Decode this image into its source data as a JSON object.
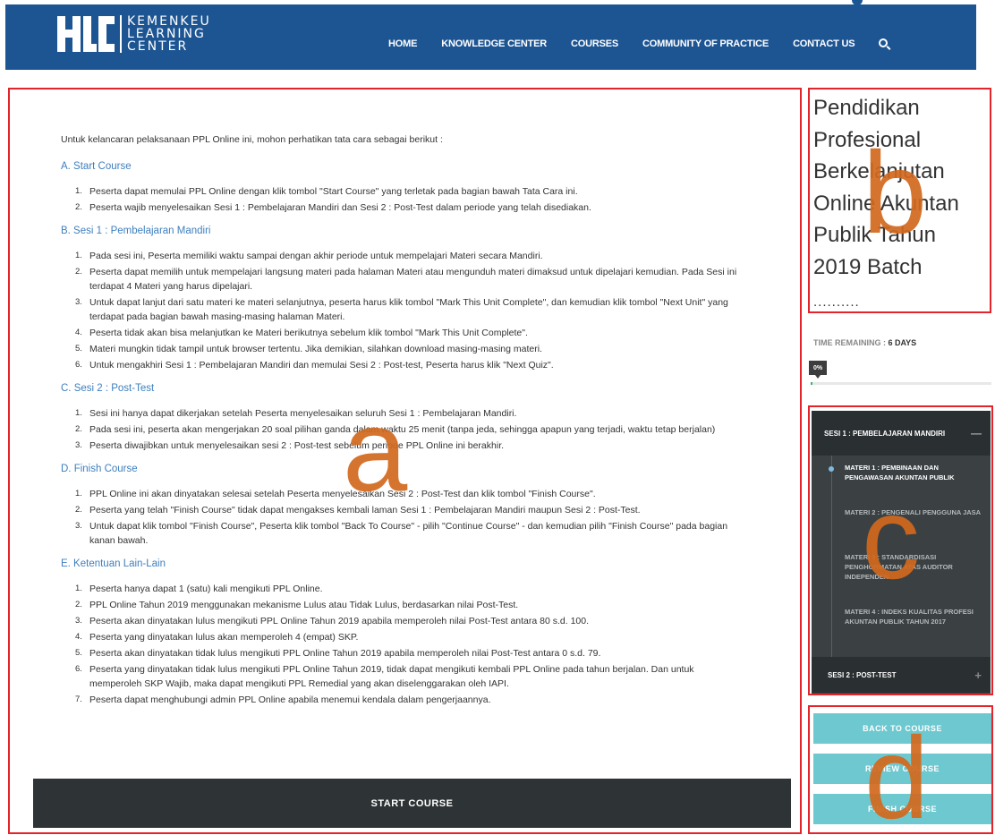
{
  "header": {
    "logo_line1": "KEMENKEU",
    "logo_line2": "LEARNING",
    "logo_line3": "CENTER",
    "nav": [
      "HOME",
      "KNOWLEDGE CENTER",
      "COURSES",
      "COMMUNITY OF PRACTICE",
      "CONTACT US"
    ],
    "search_icon": "search-icon"
  },
  "content": {
    "intro": "Untuk kelancaran pelaksanaan PPL Online ini, mohon perhatikan tata cara sebagai berikut :",
    "sections": [
      {
        "title": "A. Start Course",
        "items": [
          "Peserta dapat memulai PPL Online dengan klik tombol \"Start Course\" yang terletak pada bagian bawah Tata Cara ini.",
          "Peserta wajib menyelesaikan Sesi 1 : Pembelajaran Mandiri dan Sesi 2 : Post-Test dalam periode yang telah disediakan."
        ]
      },
      {
        "title": "B. Sesi 1 : Pembelajaran Mandiri",
        "items": [
          "Pada sesi ini, Peserta memiliki waktu sampai dengan akhir periode untuk mempelajari Materi secara Mandiri.",
          "Peserta dapat memilih untuk mempelajari langsung materi pada halaman Materi atau mengunduh materi dimaksud untuk dipelajari kemudian. Pada Sesi ini terdapat 4 Materi yang harus dipelajari.",
          "Untuk dapat lanjut dari satu materi ke materi selanjutnya, peserta harus klik tombol \"Mark This Unit Complete\", dan kemudian klik tombol \"Next Unit\" yang terdapat pada bagian bawah masing-masing halaman Materi.",
          "Peserta tidak akan bisa melanjutkan ke Materi berikutnya sebelum klik tombol \"Mark This Unit Complete\".",
          "Materi mungkin tidak tampil untuk browser tertentu. Jika demikian, silahkan download masing-masing materi.",
          "Untuk mengakhiri Sesi 1 : Pembelajaran Mandiri dan memulai Sesi 2 : Post-test, Peserta harus klik \"Next Quiz\"."
        ]
      },
      {
        "title": "C. Sesi 2 : Post-Test",
        "items": [
          "Sesi ini hanya dapat dikerjakan setelah Peserta menyelesaikan seluruh Sesi 1 : Pembelajaran Mandiri.",
          "Pada sesi ini, peserta akan mengerjakan 20 soal pilihan ganda dalam waktu 25 menit (tanpa jeda, sehingga apapun yang terjadi, waktu tetap berjalan)",
          "Peserta diwajibkan untuk menyelesaikan sesi 2 : Post-test sebelum periode PPL Online ini berakhir."
        ]
      },
      {
        "title": "D. Finish Course",
        "items": [
          "PPL Online ini akan dinyatakan selesai setelah Peserta menyelesaikan Sesi 2 : Post-Test dan klik tombol \"Finish Course\".",
          "Peserta yang telah \"Finish Course\" tidak dapat mengakses kembali laman Sesi 1 : Pembelajaran Mandiri maupun Sesi 2 : Post-Test.",
          "Untuk dapat klik tombol \"Finish Course\", Peserta klik tombol \"Back To Course\" - pilih \"Continue Course\" - dan kemudian pilih \"Finish Course\" pada bagian kanan bawah."
        ]
      },
      {
        "title": "E. Ketentuan Lain-Lain",
        "items": [
          "Peserta hanya dapat 1 (satu) kali mengikuti PPL Online.",
          "PPL Online Tahun 2019 menggunakan mekanisme Lulus atau Tidak Lulus, berdasarkan nilai Post-Test.",
          "Peserta akan dinyatakan lulus mengikuti PPL Online Tahun 2019 apabila memperoleh nilai Post-Test antara 80 s.d. 100.",
          "Peserta yang dinyatakan lulus akan memperoleh 4 (empat) SKP.",
          "Peserta akan dinyatakan tidak lulus mengikuti PPL Online Tahun 2019 apabila memperoleh nilai Post-Test antara 0 s.d. 79.",
          "Peserta yang dinyatakan tidak lulus mengikuti PPL Online Tahun 2019, tidak dapat mengikuti kembali PPL Online pada tahun berjalan. Dan untuk memperoleh SKP Wajib, maka dapat mengikuti PPL Remedial yang akan diselenggarakan oleh IAPI.",
          "Peserta dapat menghubungi admin PPL Online apabila menemui kendala dalam pengerjaannya."
        ]
      }
    ],
    "start_button": "START COURSE"
  },
  "sidebar": {
    "course_title": "Pendidikan Profesional Berkelanjutan Online Akuntan Publik Tahun 2019 Batch",
    "course_dots": "..........",
    "time_label": "TIME REMAINING : ",
    "time_value": "6 DAYS",
    "progress_label": "0%",
    "progress_fraction": 0.01,
    "modules": {
      "section1": "SESI 1 : PEMBELAJARAN MANDIRI",
      "section1_toggle": "—",
      "items": [
        "MATERI 1 : PEMBINAAN DAN PENGAWASAN AKUNTAN PUBLIK",
        "MATERI 2 : PENGENALI PENGGUNA JASA",
        "MATERI 3 : STANDARDISASI PENGHORMATAN ATAS AUDITOR INDEPENDEN",
        "MATERI 4 : INDEKS KUALITAS PROFESI AKUNTAN PUBLIK TAHUN 2017"
      ],
      "section2": "SESI 2 : POST-TEST",
      "section2_toggle": "+"
    },
    "buttons": [
      "BACK TO COURSE",
      "REVIEW COURSE",
      "FINISH COURSE"
    ]
  },
  "annotations": [
    "a",
    "b",
    "c",
    "d"
  ],
  "colors": {
    "header_bg": "#1d5593",
    "annotation_red": "#e3242b",
    "annotation_letter": "#d2691e",
    "dark_panel": "#3b4143",
    "button_teal": "#6ec8d0",
    "link_blue": "#3e7fbf"
  }
}
